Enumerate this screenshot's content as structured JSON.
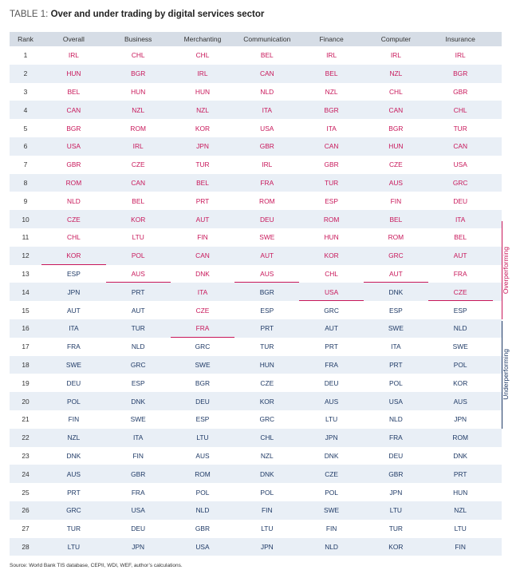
{
  "title": {
    "label": "TABLE 1:",
    "text": "Over and under trading by digital services sector"
  },
  "headers": [
    "Rank",
    "Overall",
    "Business",
    "Merchanting",
    "Communication",
    "Finance",
    "Computer",
    "Insurance"
  ],
  "rows": [
    [
      "1",
      "IRL",
      "CHL",
      "CHL",
      "BEL",
      "IRL",
      "IRL",
      "IRL"
    ],
    [
      "2",
      "HUN",
      "BGR",
      "IRL",
      "CAN",
      "BEL",
      "NZL",
      "BGR"
    ],
    [
      "3",
      "BEL",
      "HUN",
      "HUN",
      "NLD",
      "NZL",
      "CHL",
      "GBR"
    ],
    [
      "4",
      "CAN",
      "NZL",
      "NZL",
      "ITA",
      "BGR",
      "CAN",
      "CHL"
    ],
    [
      "5",
      "BGR",
      "ROM",
      "KOR",
      "USA",
      "ITA",
      "BGR",
      "TUR"
    ],
    [
      "6",
      "USA",
      "IRL",
      "JPN",
      "GBR",
      "CAN",
      "HUN",
      "CAN"
    ],
    [
      "7",
      "GBR",
      "CZE",
      "TUR",
      "IRL",
      "GBR",
      "CZE",
      "USA"
    ],
    [
      "8",
      "ROM",
      "CAN",
      "BEL",
      "FRA",
      "TUR",
      "AUS",
      "GRC"
    ],
    [
      "9",
      "NLD",
      "BEL",
      "PRT",
      "ROM",
      "ESP",
      "FIN",
      "DEU"
    ],
    [
      "10",
      "CZE",
      "KOR",
      "AUT",
      "DEU",
      "ROM",
      "BEL",
      "ITA"
    ],
    [
      "11",
      "CHL",
      "LTU",
      "FIN",
      "SWE",
      "HUN",
      "ROM",
      "BEL"
    ],
    [
      "12",
      "KOR",
      "POL",
      "CAN",
      "AUT",
      "KOR",
      "GRC",
      "AUT"
    ],
    [
      "13",
      "ESP",
      "AUS",
      "DNK",
      "AUS",
      "CHL",
      "AUT",
      "FRA"
    ],
    [
      "14",
      "JPN",
      "PRT",
      "ITA",
      "BGR",
      "USA",
      "DNK",
      "CZE"
    ],
    [
      "15",
      "AUT",
      "AUT",
      "CZE",
      "ESP",
      "GRC",
      "ESP",
      "ESP"
    ],
    [
      "16",
      "ITA",
      "TUR",
      "FRA",
      "PRT",
      "AUT",
      "SWE",
      "NLD"
    ],
    [
      "17",
      "FRA",
      "NLD",
      "GRC",
      "TUR",
      "PRT",
      "ITA",
      "SWE"
    ],
    [
      "18",
      "SWE",
      "GRC",
      "SWE",
      "HUN",
      "FRA",
      "PRT",
      "POL"
    ],
    [
      "19",
      "DEU",
      "ESP",
      "BGR",
      "CZE",
      "DEU",
      "POL",
      "KOR"
    ],
    [
      "20",
      "POL",
      "DNK",
      "DEU",
      "KOR",
      "AUS",
      "USA",
      "AUS"
    ],
    [
      "21",
      "FIN",
      "SWE",
      "ESP",
      "GRC",
      "LTU",
      "NLD",
      "JPN"
    ],
    [
      "22",
      "NZL",
      "ITA",
      "LTU",
      "CHL",
      "JPN",
      "FRA",
      "ROM"
    ],
    [
      "23",
      "DNK",
      "FIN",
      "AUS",
      "NZL",
      "DNK",
      "DEU",
      "DNK"
    ],
    [
      "24",
      "AUS",
      "GBR",
      "ROM",
      "DNK",
      "CZE",
      "GBR",
      "PRT"
    ],
    [
      "25",
      "PRT",
      "FRA",
      "POL",
      "POL",
      "POL",
      "JPN",
      "HUN"
    ],
    [
      "26",
      "GRC",
      "USA",
      "NLD",
      "FIN",
      "SWE",
      "LTU",
      "NZL"
    ],
    [
      "27",
      "TUR",
      "DEU",
      "GBR",
      "LTU",
      "FIN",
      "TUR",
      "LTU"
    ],
    [
      "28",
      "LTU",
      "JPN",
      "USA",
      "JPN",
      "NLD",
      "KOR",
      "FIN"
    ]
  ],
  "overperforming_count": [
    12,
    13,
    16,
    13,
    14,
    13,
    14
  ],
  "legend": {
    "over": "Overperforming",
    "under": "Underperforming"
  },
  "colors": {
    "over": "#c8175a",
    "under": "#1f3a66",
    "header_bg": "#d6dde6",
    "row_alt_bg": "#e9eff6"
  },
  "source": "Source: World Bank TIS database, CEPII, WDI, WEF, author’s calculations."
}
